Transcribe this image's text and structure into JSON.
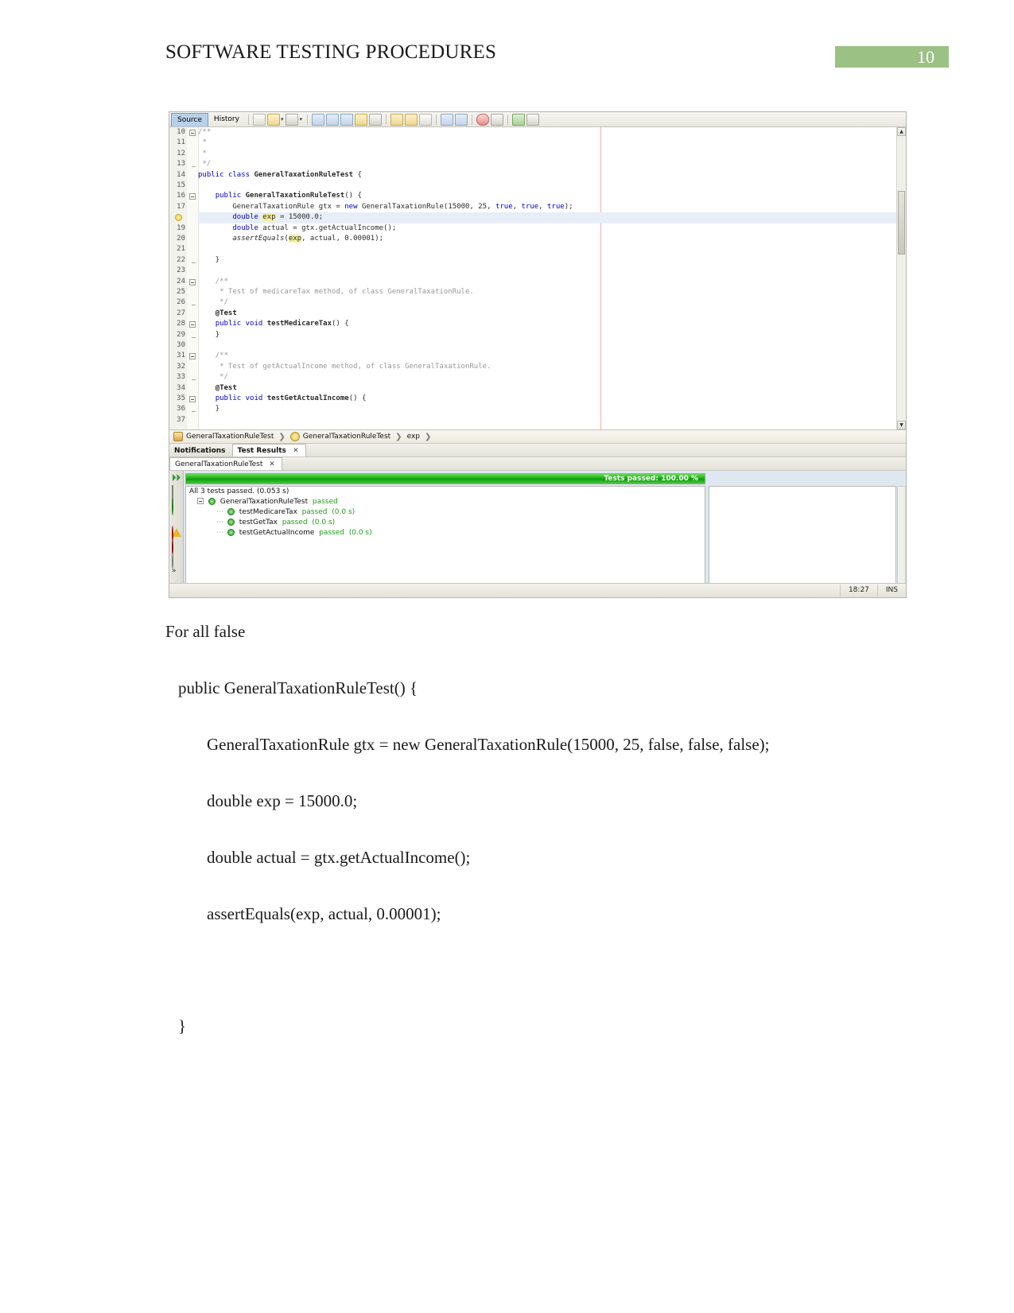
{
  "document": {
    "header_title": "SOFTWARE TESTING PROCEDURES",
    "page_number": "10",
    "header_accent_color": "#9cc185"
  },
  "screenshot": {
    "app": "NetBeans IDE",
    "toolbar": {
      "tabs": [
        {
          "label": "Source",
          "active": true
        },
        {
          "label": "History",
          "active": false
        }
      ]
    },
    "editor": {
      "caret_guide_color": "#f0b0b0",
      "highlight_color": "#e8eef7",
      "lines": [
        {
          "num": "10",
          "text": "/**",
          "style": "comment",
          "fold": "start"
        },
        {
          "num": "11",
          "text": " *",
          "style": "comment"
        },
        {
          "num": "12",
          "text": " *",
          "style": "comment"
        },
        {
          "num": "13",
          "text": " */",
          "style": "comment",
          "fold": "end"
        },
        {
          "num": "14",
          "text": "public class GeneralTaxationRuleTest {",
          "style": "code"
        },
        {
          "num": "15",
          "text": "",
          "style": "code"
        },
        {
          "num": "16",
          "text": "    public GeneralTaxationRuleTest() {",
          "style": "code",
          "fold": "start"
        },
        {
          "num": "17",
          "text": "        GeneralTaxationRule gtx = new GeneralTaxationRule(15000, 25, true, true, true);",
          "style": "code"
        },
        {
          "num": "18",
          "text": "        double exp = 15000.0;",
          "style": "code",
          "highlight": true,
          "bulb": true
        },
        {
          "num": "19",
          "text": "        double actual = gtx.getActualIncome();",
          "style": "code"
        },
        {
          "num": "20",
          "text": "        assertEquals(exp, actual, 0.00001);",
          "style": "code"
        },
        {
          "num": "21",
          "text": "",
          "style": "code"
        },
        {
          "num": "22",
          "text": "    }",
          "style": "code",
          "fold": "end"
        },
        {
          "num": "23",
          "text": "",
          "style": "code"
        },
        {
          "num": "24",
          "text": "    /**",
          "style": "comment",
          "fold": "start"
        },
        {
          "num": "25",
          "text": "     * Test of medicareTax method, of class GeneralTaxationRule.",
          "style": "comment"
        },
        {
          "num": "26",
          "text": "     */",
          "style": "comment",
          "fold": "end"
        },
        {
          "num": "27",
          "text": "    @Test",
          "style": "annotation"
        },
        {
          "num": "28",
          "text": "    public void testMedicareTax() {",
          "style": "code",
          "fold": "start"
        },
        {
          "num": "29",
          "text": "    }",
          "style": "code",
          "fold": "end"
        },
        {
          "num": "30",
          "text": "",
          "style": "code"
        },
        {
          "num": "31",
          "text": "    /**",
          "style": "comment",
          "fold": "start"
        },
        {
          "num": "32",
          "text": "     * Test of getActualIncome method, of class GeneralTaxationRule.",
          "style": "comment"
        },
        {
          "num": "33",
          "text": "     */",
          "style": "comment",
          "fold": "end"
        },
        {
          "num": "34",
          "text": "    @Test",
          "style": "annotation"
        },
        {
          "num": "35",
          "text": "    public void testGetActualIncome() {",
          "style": "code",
          "fold": "start"
        },
        {
          "num": "36",
          "text": "    }",
          "style": "code",
          "fold": "end"
        },
        {
          "num": "37",
          "text": "",
          "style": "code"
        }
      ]
    },
    "breadcrumb": [
      {
        "label": "GeneralTaxationRuleTest",
        "icon": "class-icon"
      },
      {
        "label": "GeneralTaxationRuleTest",
        "icon": "constructor-icon"
      },
      {
        "label": "exp",
        "icon": "none"
      }
    ],
    "output_tabs": [
      {
        "label": "Notifications",
        "active": false,
        "closable": false
      },
      {
        "label": "Test Results",
        "active": true,
        "closable": true
      }
    ],
    "result_subtabs": [
      {
        "label": "GeneralTaxationRuleTest",
        "active": true,
        "closable": true
      }
    ],
    "test_results": {
      "progress_label": "Tests passed: 100.00 %",
      "progress_percent": 100,
      "progress_color": "#17a811",
      "summary": "All 3 tests passed. (0.053 s)",
      "root": {
        "name": "GeneralTaxationRuleTest",
        "status": "passed"
      },
      "items": [
        {
          "name": "testMedicareTax",
          "status": "passed",
          "time": "(0.0 s)"
        },
        {
          "name": "testGetTax",
          "status": "passed",
          "time": "(0.0 s)"
        },
        {
          "name": "testGetActualIncome",
          "status": "passed",
          "time": "(0.0 s)"
        }
      ],
      "sidebar_icons": [
        "run-again-icon",
        "rerun-failed-icon",
        "filter-passed-icon",
        "filter-warning-icon",
        "filter-error-icon",
        "filter-failed-icon",
        "filter-skipped-icon",
        "expand-more-icon"
      ]
    },
    "statusbar": {
      "position": "18:27",
      "mode": "INS"
    }
  },
  "content": {
    "intro": "For all false",
    "code_block": [
      {
        "indent": 1,
        "text": "public GeneralTaxationRuleTest() {"
      },
      {
        "indent": 2,
        "text": "GeneralTaxationRule gtx = new GeneralTaxationRule(15000, 25, false, false, false);"
      },
      {
        "indent": 2,
        "text": "double exp = 15000.0;"
      },
      {
        "indent": 2,
        "text": "double actual = gtx.getActualIncome();"
      },
      {
        "indent": 2,
        "text": "assertEquals(exp, actual, 0.00001);"
      },
      {
        "indent": 1,
        "text": "}"
      }
    ]
  }
}
